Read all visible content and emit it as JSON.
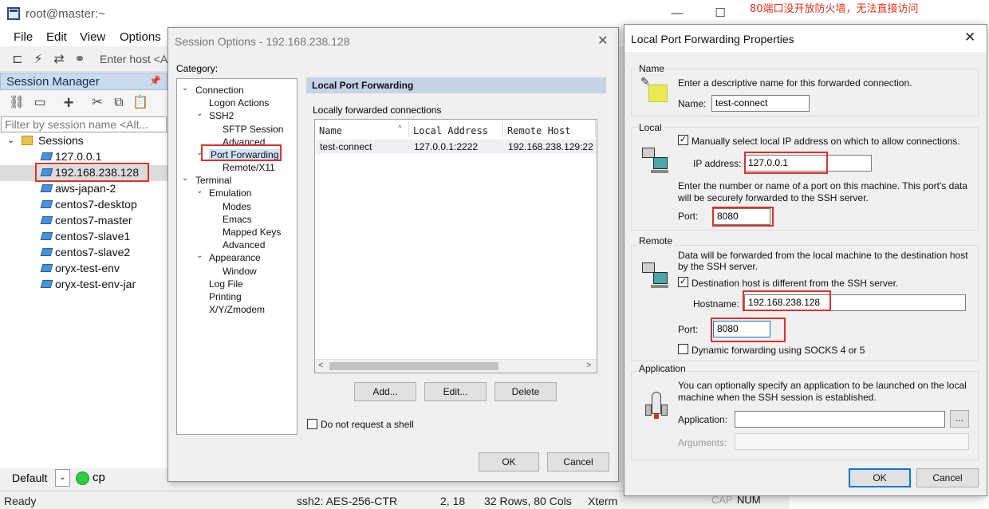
{
  "window": {
    "title": "root@master:~",
    "bg_text": "80端口没开放防火墙，无法直接访问",
    "controls": {
      "minimize": "—",
      "maximize": "☐",
      "close": "✕"
    }
  },
  "menu": [
    "File",
    "Edit",
    "View",
    "Options"
  ],
  "toolbar": {
    "enter_host": "Enter host <A"
  },
  "session_manager": {
    "title": "Session Manager",
    "pin": "📌",
    "filter_placeholder": "Filter by session name <Alt...",
    "root": "Sessions",
    "items": [
      "127.0.0.1",
      "192.168.238.128",
      "aws-japan-2",
      "centos7-desktop",
      "centos7-master",
      "centos7-slave1",
      "centos7-slave2",
      "oryx-test-env",
      "oryx-test-env-jar"
    ],
    "selected": "192.168.238.128"
  },
  "bottom": {
    "default_label": "Default",
    "cp_label": "cp"
  },
  "status": {
    "ready": "Ready",
    "cipher": "ssh2: AES-256-CTR",
    "pos": "2,  18",
    "size": "32 Rows, 80 Cols",
    "term": "Xterm",
    "cap": "CAP",
    "num": "NUM"
  },
  "session_options": {
    "title": "Session Options - 192.168.238.128",
    "category_label": "Category:",
    "categories": {
      "connection": "Connection",
      "logon_actions": "Logon Actions",
      "ssh2": "SSH2",
      "sftp_session": "SFTP Session",
      "advanced": "Advanced",
      "port_forwarding": "Port Forwarding",
      "remote_x11": "Remote/X11",
      "terminal": "Terminal",
      "emulation": "Emulation",
      "modes": "Modes",
      "emacs": "Emacs",
      "mapped_keys": "Mapped Keys",
      "advanced2": "Advanced",
      "appearance": "Appearance",
      "window": "Window",
      "log_file": "Log File",
      "printing": "Printing",
      "xyz": "X/Y/Zmodem"
    },
    "section_header": "Local Port Forwarding",
    "list_label": "Locally forwarded connections",
    "columns": {
      "name": "Name",
      "local": "Local Address",
      "remote": "Remote Host"
    },
    "row": {
      "name": "test-connect",
      "local": "127.0.0.1:2222",
      "remote": "192.168.238.129:22"
    },
    "buttons": {
      "add": "Add...",
      "edit": "Edit...",
      "delete": "Delete",
      "ok": "OK",
      "cancel": "Cancel"
    },
    "no_shell": "Do not request a shell"
  },
  "lpf_dialog": {
    "title": "Local Port Forwarding Properties",
    "name_group": "Name",
    "name_desc": "Enter a descriptive name for this forwarded connection.",
    "name_label": "Name:",
    "name_value": "test-connect",
    "local_group": "Local",
    "local_manual": "Manually select local IP address on which to allow connections.",
    "ip_label": "IP address:",
    "ip_value": "127.0.0.1",
    "port_desc_1": "Enter the number or name of a port on this machine.  This port's data",
    "port_desc_2": "will be securely forwarded to the SSH server.",
    "port_label": "Port:",
    "local_port_value": "8080",
    "remote_group": "Remote",
    "remote_desc_1": "Data will be forwarded from the local machine to the destination host",
    "remote_desc_2": "by the SSH server.",
    "dest_diff": "Destination host is different from the SSH server.",
    "hostname_label": "Hostname:",
    "hostname_value": "192.168.238.128",
    "remote_port_label": "Port:",
    "remote_port_value": "8080",
    "dynamic": "Dynamic forwarding using SOCKS 4 or 5",
    "app_group": "Application",
    "app_desc_1": "You can optionally specify an application to be launched on the local",
    "app_desc_2": "machine when the SSH session is established.",
    "app_label": "Application:",
    "browse": "...",
    "args_label": "Arguments:",
    "ok": "OK",
    "cancel": "Cancel",
    "check_mark": "✓"
  }
}
